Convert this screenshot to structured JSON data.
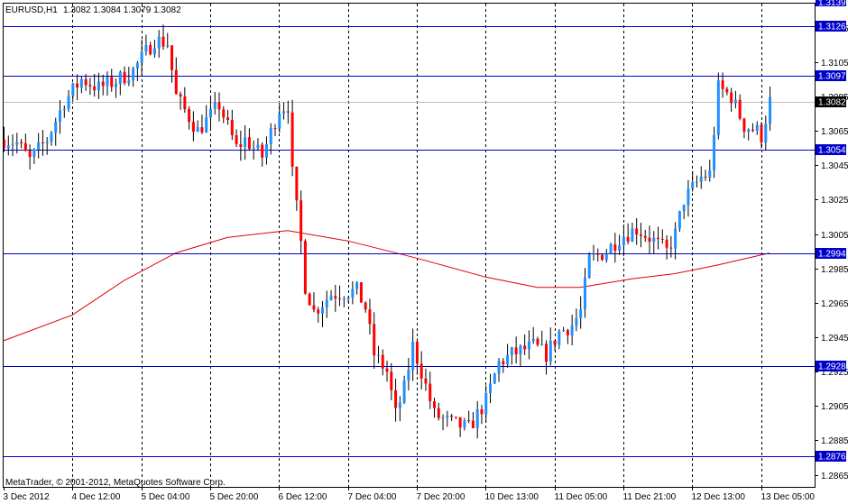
{
  "header": {
    "symbol_timeframe": "EURUSD,H1",
    "ohlc": "1.3082 1.3084 1.3079 1.3082"
  },
  "footer": {
    "copyright": "MetaTrader, © 2001-2012, MetaQuotes Software Corp."
  },
  "colors": {
    "background": "#ffffff",
    "axis": "#000000",
    "grid": "#000000",
    "bull": "#1e90ff",
    "bear": "#ff0000",
    "wick": "#000000",
    "ma": "#e00000",
    "level_line": "#0000cc",
    "level_box": "#0000cc",
    "price_box": "#000000",
    "bid_line": "#c0c0c0"
  },
  "chart_data": {
    "type": "candlestick",
    "symbol": "EURUSD",
    "timeframe": "H1",
    "ylim": [
      1.2858,
      1.3139
    ],
    "y_ticks": [
      "1.3125",
      "1.3105",
      "1.3085",
      "1.3065",
      "1.3045",
      "1.3025",
      "1.3005",
      "1.2985",
      "1.2965",
      "1.2945",
      "1.2925",
      "1.2905",
      "1.2885",
      "1.2865"
    ],
    "top_label": "1.3139",
    "x_labels": [
      "3 Dec 2012",
      "4 Dec 12:00",
      "5 Dec 04:00",
      "5 Dec 20:00",
      "6 Dec 12:00",
      "7 Dec 04:00",
      "7 Dec 20:00",
      "10 Dec 13:00",
      "11 Dec 05:00",
      "11 Dec 21:00",
      "12 Dec 13:00",
      "13 Dec 05:00"
    ],
    "x_label_bars": [
      0,
      16,
      32,
      48,
      64,
      80,
      96,
      112,
      128,
      144,
      160,
      176
    ],
    "grid": true,
    "last_price": "1.3082",
    "levels": [
      "1.3126",
      "1.3097",
      "1.3054",
      "1.2994",
      "1.2928",
      "1.2876"
    ],
    "ma_anchors": [
      [
        0,
        1.2943
      ],
      [
        16,
        1.2958
      ],
      [
        28,
        1.2978
      ],
      [
        40,
        1.2994
      ],
      [
        52,
        1.3003
      ],
      [
        66,
        1.3007
      ],
      [
        80,
        1.3001
      ],
      [
        96,
        1.2991
      ],
      [
        112,
        1.298
      ],
      [
        124,
        1.2974
      ],
      [
        134,
        1.2974
      ],
      [
        146,
        1.2979
      ],
      [
        156,
        1.2982
      ],
      [
        166,
        1.2987
      ],
      [
        178,
        1.2994
      ]
    ],
    "close_anchors": [
      [
        0,
        1.306
      ],
      [
        3,
        1.3058
      ],
      [
        6,
        1.3048
      ],
      [
        10,
        1.306
      ],
      [
        14,
        1.3082
      ],
      [
        18,
        1.3095
      ],
      [
        22,
        1.309
      ],
      [
        26,
        1.3094
      ],
      [
        30,
        1.31
      ],
      [
        35,
        1.3118
      ],
      [
        38,
        1.3116
      ],
      [
        40,
        1.3085
      ],
      [
        45,
        1.3065
      ],
      [
        50,
        1.308
      ],
      [
        54,
        1.3055
      ],
      [
        56,
        1.306
      ],
      [
        60,
        1.305
      ],
      [
        64,
        1.3078
      ],
      [
        66,
        1.308
      ],
      [
        67,
        1.304
      ],
      [
        69,
        1.3
      ],
      [
        70,
        1.2975
      ],
      [
        72,
        1.296
      ],
      [
        76,
        1.297
      ],
      [
        82,
        1.2972
      ],
      [
        84,
        1.2962
      ],
      [
        86,
        1.2935
      ],
      [
        89,
        1.2925
      ],
      [
        91,
        1.29
      ],
      [
        93,
        1.2915
      ],
      [
        95,
        1.294
      ],
      [
        97,
        1.2925
      ],
      [
        100,
        1.29
      ],
      [
        104,
        1.2895
      ],
      [
        108,
        1.2892
      ],
      [
        112,
        1.2908
      ],
      [
        115,
        1.293
      ],
      [
        118,
        1.2935
      ],
      [
        123,
        1.294
      ],
      [
        126,
        1.2935
      ],
      [
        129,
        1.2948
      ],
      [
        132,
        1.2952
      ],
      [
        134,
        1.296
      ],
      [
        136,
        1.299
      ],
      [
        140,
        1.2995
      ],
      [
        143,
        1.3003
      ],
      [
        147,
        1.3008
      ],
      [
        150,
        1.3003
      ],
      [
        154,
        1.2995
      ],
      [
        156,
        1.3005
      ],
      [
        158,
        1.3025
      ],
      [
        162,
        1.3038
      ],
      [
        164,
        1.304
      ],
      [
        166,
        1.309
      ],
      [
        169,
        1.3085
      ],
      [
        172,
        1.3068
      ],
      [
        175,
        1.3065
      ],
      [
        176,
        1.3062
      ],
      [
        178,
        1.3082
      ]
    ],
    "bars": 179
  }
}
